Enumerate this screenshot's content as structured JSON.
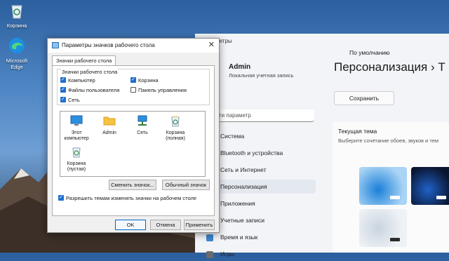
{
  "desktop": {
    "icons": [
      {
        "label": "Корзина",
        "icon": "recycle-bin-icon"
      },
      {
        "label": "Microsoft Edge",
        "icon": "edge-icon"
      }
    ]
  },
  "settings": {
    "window_title": "Параметры",
    "user": {
      "name": "Admin",
      "subtitle": "Локальная учетная запись"
    },
    "search_placeholder": "ти параметр",
    "nav": [
      {
        "label": "Система",
        "icon": "monitor-icon",
        "color": "#3a7bd5"
      },
      {
        "label": "Bluetooth и устройства",
        "icon": "bluetooth-icon",
        "color": "#2f7de1"
      },
      {
        "label": "Сеть и Интернет",
        "icon": "network-icon",
        "color": "#4a7fbf"
      },
      {
        "label": "Персонализация",
        "icon": "brush-icon",
        "color": "#d07a2a",
        "active": true
      },
      {
        "label": "Приложения",
        "icon": "apps-icon",
        "color": "#5b6f8c"
      },
      {
        "label": "Учетные записи",
        "icon": "account-icon",
        "color": "#2f9a5a"
      },
      {
        "label": "Время и язык",
        "icon": "clock-globe-icon",
        "color": "#3d86d1"
      },
      {
        "label": "Игры",
        "icon": "gamepad-icon",
        "color": "#6b6b6b"
      }
    ],
    "heading": "Персонализация  ›  Т",
    "default_label": "По умолчанию",
    "save_button": "Сохранить",
    "theme_card": {
      "title": "Текущая тема",
      "subtitle": "Выберите сочетание обоев, звуков и тем"
    }
  },
  "dialog": {
    "title": "Параметры значков рабочего стола",
    "close_glyph": "✕",
    "tab_label": "Значки рабочего стола",
    "group_title": "Значки рабочего стола",
    "checkboxes": [
      {
        "label": "Компьютер",
        "checked": true
      },
      {
        "label": "Корзина",
        "checked": true
      },
      {
        "label": "Файлы пользователя",
        "checked": true
      },
      {
        "label": "Панель управления",
        "checked": false
      },
      {
        "label": "Сеть",
        "checked": true
      }
    ],
    "icon_items": [
      {
        "label": "Этот компьютер",
        "icon": "computer-icon"
      },
      {
        "label": "Admin",
        "icon": "folder-icon"
      },
      {
        "label": "Сеть",
        "icon": "network-icon"
      },
      {
        "label": "Корзина (полная)",
        "icon": "recycle-bin-full-icon"
      },
      {
        "label": "Корзина (пустая)",
        "icon": "recycle-bin-empty-icon"
      }
    ],
    "change_icon_button": "Сменить значок...",
    "default_icon_button": "Обычный значок",
    "allow_themes_label": "Разрешить темам изменять значки на рабочем столе",
    "allow_themes_checked": true,
    "ok_button": "OK",
    "cancel_button": "Отмена",
    "apply_button": "Применить"
  }
}
